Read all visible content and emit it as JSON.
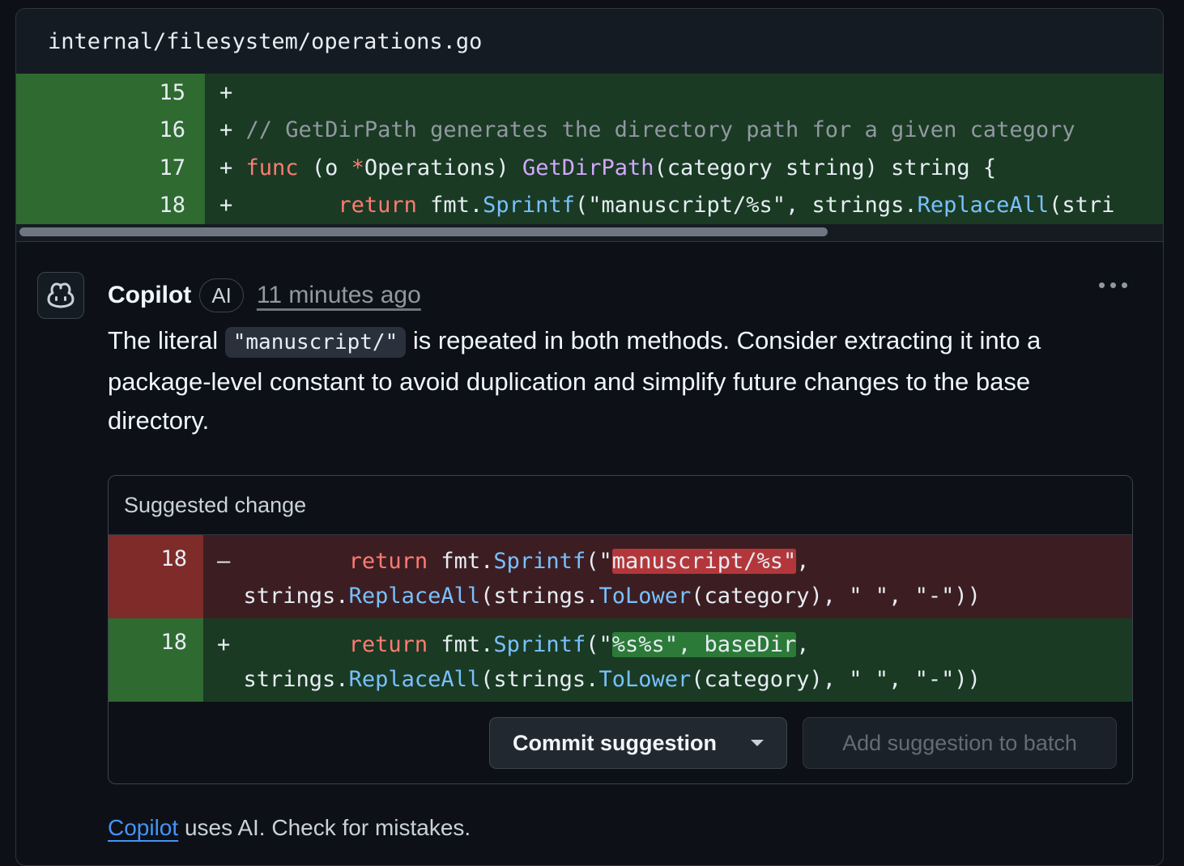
{
  "file": {
    "path": "internal/filesystem/operations.go"
  },
  "diff_lines": [
    {
      "num": "15",
      "sign": "+",
      "tokens": []
    },
    {
      "num": "16",
      "sign": "+",
      "tokens": [
        {
          "t": " ",
          "c": ""
        },
        {
          "t": "// GetDirPath generates the directory path for a given category",
          "c": "cm"
        }
      ]
    },
    {
      "num": "17",
      "sign": "+",
      "tokens": [
        {
          "t": " ",
          "c": ""
        },
        {
          "t": "func",
          "c": "kw"
        },
        {
          "t": " (o ",
          "c": ""
        },
        {
          "t": "*",
          "c": "kw"
        },
        {
          "t": "Operations) ",
          "c": ""
        },
        {
          "t": "GetDirPath",
          "c": "fn2"
        },
        {
          "t": "(category string) string {",
          "c": ""
        }
      ]
    },
    {
      "num": "18",
      "sign": "+",
      "tokens": [
        {
          "t": "        ",
          "c": ""
        },
        {
          "t": "return",
          "c": "kw"
        },
        {
          "t": " fmt.",
          "c": ""
        },
        {
          "t": "Sprintf",
          "c": "fn"
        },
        {
          "t": "(\"manuscript/%s\", strings.",
          "c": ""
        },
        {
          "t": "ReplaceAll",
          "c": "fn"
        },
        {
          "t": "(stri",
          "c": ""
        }
      ]
    }
  ],
  "comment": {
    "author": "Copilot",
    "badge": "AI",
    "timestamp": "11 minutes ago",
    "body_before": "The literal ",
    "body_code": "\"manuscript/\"",
    "body_after": " is repeated in both methods. Consider extracting it into a package-level constant to avoid duplication and simplify future changes to the base directory."
  },
  "suggestion": {
    "title": "Suggested change",
    "deleted": {
      "num": "18",
      "sign": "–",
      "line1_pre": "        return",
      "line1_mid": " fmt.",
      "line1_fn": "Sprintf",
      "line1_open": "(\"",
      "line1_hl": "manuscript/%s\"",
      "line1_end": ",",
      "line2": "strings.ReplaceAll(strings.ToLower(category), \" \", \"-\"))"
    },
    "added": {
      "num": "18",
      "sign": "+",
      "line1_hl": "%s%s\", baseDir",
      "line1_end": ","
    },
    "commit_label": "Commit suggestion",
    "batch_label": "Add suggestion to batch"
  },
  "footer": {
    "link": "Copilot",
    "text": " uses AI. Check for mistakes."
  },
  "colors": {
    "keyword": "#ff7b72",
    "function": "#79c0ff",
    "comment": "#9198a1",
    "link": "#4493f8"
  }
}
